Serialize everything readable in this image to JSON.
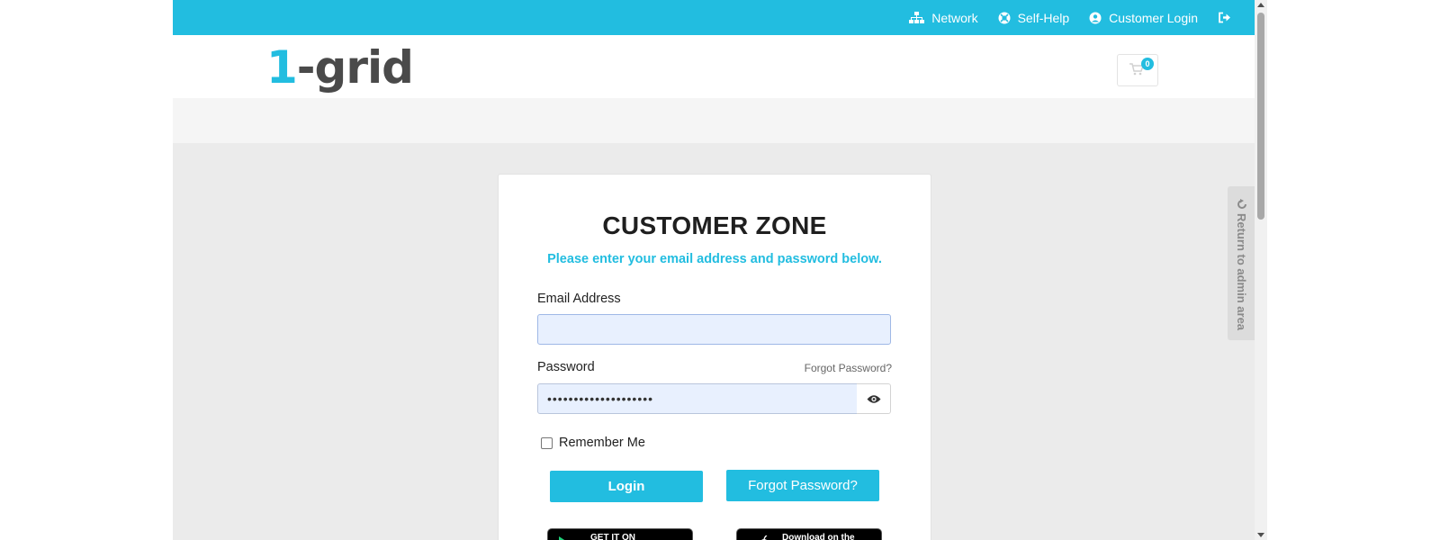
{
  "topbar": {
    "links": [
      {
        "label": "Network",
        "icon": "sitemap-icon"
      },
      {
        "label": "Self-Help",
        "icon": "lifebuoy-icon"
      },
      {
        "label": "Customer Login",
        "icon": "user-circle-icon"
      },
      {
        "label": "",
        "icon": "sign-out-icon"
      }
    ]
  },
  "header": {
    "logo": {
      "part1": "1",
      "part2": "-grid"
    },
    "cart": {
      "count": "0",
      "icon": "shopping-cart-icon"
    }
  },
  "login": {
    "title": "CUSTOMER ZONE",
    "subtitle": "Please enter your email address and password below.",
    "email_label": "Email Address",
    "email_value": "",
    "password_label": "Password",
    "forgot_link": "Forgot Password?",
    "password_value": "••••••••••••••••••••",
    "remember_label": "Remember Me",
    "login_button": "Login",
    "forgot_button": "Forgot Password?",
    "google_play": "GET IT ON",
    "app_store": "Download on the"
  },
  "sidetab": {
    "label": "Return to admin area",
    "icon": "undo-icon"
  },
  "colors": {
    "accent": "#22bde0",
    "background": "#ebebeb"
  }
}
